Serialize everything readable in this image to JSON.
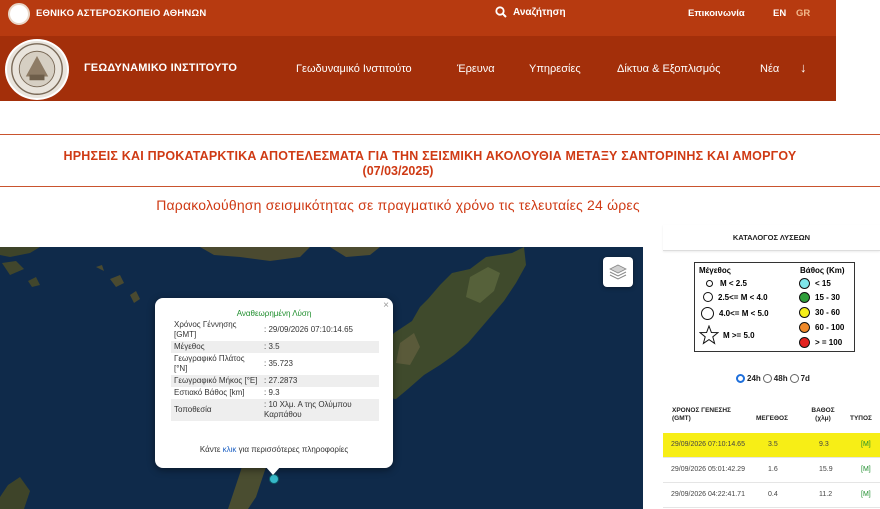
{
  "topbar": {
    "org": "ΕΘΝΙΚΟ ΑΣΤΕΡΟΣΚΟΠΕΙΟ ΑΘΗΝΩΝ",
    "search": "Αναζήτηση",
    "contact": "Επικοινωνία",
    "lang_en": "EN",
    "lang_gr": "GR"
  },
  "navbar": {
    "brand": "ΓΕΩΔΥΝΑΜΙΚΟ ΙΝΣΤΙΤΟΥΤΟ",
    "items": [
      "Γεωδυναμικό Ινστιτούτο",
      "Έρευνα",
      "Υπηρεσίες",
      "Δίκτυα & Εξοπλισμός",
      "Νέα"
    ],
    "arrow": "↓"
  },
  "heading": {
    "line1": "ΗΡΗΣΕΙΣ ΚΑΙ ΠΡΟΚΑΤΑΡΚΤΙΚΑ ΑΠΟΤΕΛΕΣΜΑΤΑ ΓΙΑ ΤΗΝ ΣΕΙΣΜΙΚΗ ΑΚΟΛΟΥΘΙΑ ΜΕΤΑΞΥ ΣΑΝΤΟΡΙΝΗΣ ΚΑΙ ΑΜΟΡΓΟΥ",
    "line2": "(07/03/2025)",
    "subtitle": "Παρακολούθηση σεισμικότητας σε πραγματικό χρόνο τις τελευταίες 24 ώρες"
  },
  "popup": {
    "title": "Αναθεωρημένη Λύση",
    "close": "×",
    "rows": [
      {
        "k": "Χρόνος Γέννησης [GMT]",
        "v": ": 29/09/2026 07:10:14.65"
      },
      {
        "k": "Μέγεθος",
        "v": ": 3.5"
      },
      {
        "k": "Γεωγραφικό Πλάτος [°N]",
        "v": ": 35.723"
      },
      {
        "k": "Γεωγραφικό Μήκος [°E]",
        "v": ": 27.2873"
      },
      {
        "k": "Εστιακό Βάθος [km]",
        "v": ": 9.3"
      },
      {
        "k": "Τοποθεσία",
        "v": ": 10 Χλμ. Α της Ολύμπου Καρπάθου"
      }
    ],
    "more_pre": "Κάντε ",
    "more_link": "κλικ",
    "more_post": " για περισσότερες πληροφορίες"
  },
  "panel": {
    "title": "ΚΑΤΑΛΟΓΟΣ ΛΥΣΕΩΝ",
    "legend": {
      "mag_header": "Μέγεθος",
      "depth_header": "Βάθος (Km)",
      "mags": [
        "M < 2.5",
        "2.5<= M < 4.0",
        "4.0<= M < 5.0",
        "M >= 5.0"
      ],
      "depths": [
        {
          "label": "< 15",
          "color": "#7fe6ea"
        },
        {
          "label": "15 - 30",
          "color": "#2e9e3a"
        },
        {
          "label": "30 - 60",
          "color": "#f5ef1a"
        },
        {
          "label": "60 - 100",
          "color": "#f08a2b"
        },
        {
          "label": "> = 100",
          "color": "#e3221f"
        }
      ]
    },
    "radios": [
      "24h",
      "48h",
      "7d"
    ],
    "columns": [
      "ΧΡΟΝΟΣ ΓΕΝΕΣΗΣ (GMT)",
      "ΜΕΓΕΘΟΣ",
      "ΒΑΘΟΣ (χλμ)",
      "ΤΥΠΟΣ"
    ],
    "rows": [
      {
        "time": "29/09/2026 07:10:14.65",
        "mag": "3.5",
        "depth": "9.3",
        "type": "[M]"
      },
      {
        "time": "29/09/2026 05:01:42.29",
        "mag": "1.6",
        "depth": "15.9",
        "type": "[M]"
      },
      {
        "time": "29/09/2026 04:22:41.71",
        "mag": "0.4",
        "depth": "11.2",
        "type": "[M]"
      }
    ]
  }
}
